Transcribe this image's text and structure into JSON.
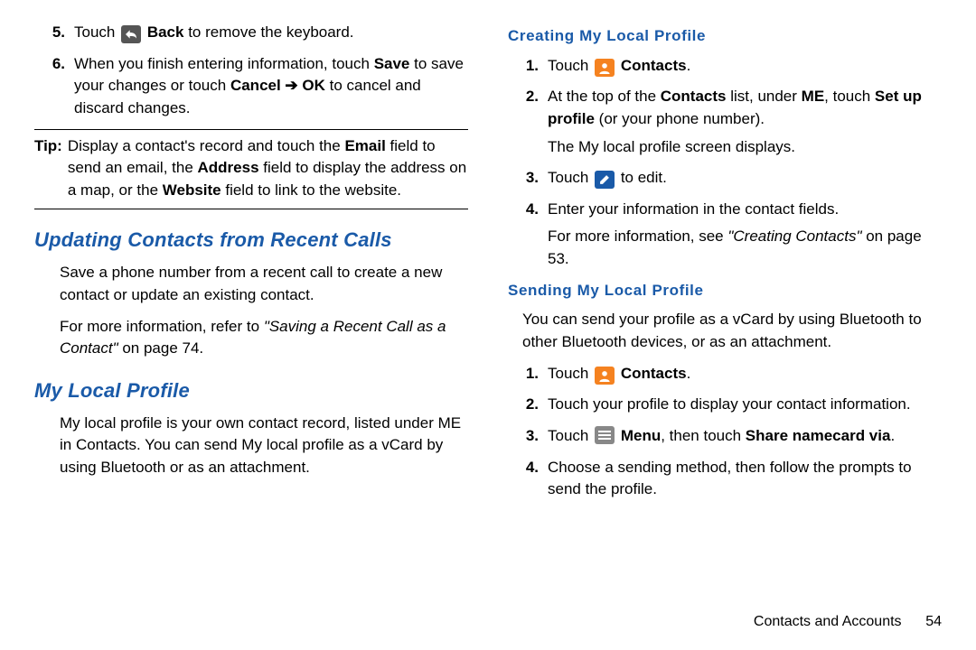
{
  "left": {
    "items56": {
      "5": {
        "num": "5.",
        "pre": "Touch ",
        "bold": "Back",
        "post": " to remove the keyboard."
      },
      "6": {
        "num": "6.",
        "t1": "When you finish entering information, touch ",
        "save": "Save",
        "t2": " to save your changes or touch ",
        "cancel": "Cancel",
        "arrow": " ➔ ",
        "ok": "OK",
        "t3": " to cancel and discard changes."
      }
    },
    "tip": {
      "label": "Tip:",
      "t1": "Display a contact's record and touch the ",
      "email": "Email",
      "t2": " field to send an email, the ",
      "address": "Address",
      "t3": " field to display the address on a map, or the ",
      "website": "Website",
      "t4": " field to link to the website."
    },
    "h_update": "Updating Contacts from Recent Calls",
    "update_p": "Save a phone number from a recent call to create a new contact or update an existing contact.",
    "update_ref_pre": "For more information, refer to ",
    "update_ref_italic": "\"Saving a Recent Call as a Contact\"",
    "update_ref_post": " on page 74.",
    "h_profile": "My Local Profile",
    "profile_p": "My local profile is your own contact record, listed under ME in Contacts. You can send My local profile as a vCard by using Bluetooth or as an attachment."
  },
  "right": {
    "h_create": "Creating My Local Profile",
    "create": {
      "1": {
        "num": "1.",
        "pre": "Touch ",
        "bold": "Contacts",
        "post": "."
      },
      "2": {
        "num": "2.",
        "t1": "At the top of the ",
        "contacts": "Contacts",
        "t2": " list, under ",
        "me": "ME",
        "t3": ", touch ",
        "setup": "Set up profile",
        "t4": " (or your phone number).",
        "sub": "The My local profile screen displays."
      },
      "3": {
        "num": "3.",
        "pre": "Touch ",
        "post": " to edit."
      },
      "4": {
        "num": "4.",
        "t1": "Enter your information in the contact fields.",
        "sub_pre": "For more information, see ",
        "sub_italic": "\"Creating Contacts\"",
        "sub_post": " on page 53."
      }
    },
    "h_send": "Sending My Local Profile",
    "send_p": "You can send your profile as a vCard by using Bluetooth to other Bluetooth devices, or as an attachment.",
    "send": {
      "1": {
        "num": "1.",
        "pre": "Touch ",
        "bold": "Contacts",
        "post": "."
      },
      "2": {
        "num": "2.",
        "text": "Touch your profile to display your contact information."
      },
      "3": {
        "num": "3.",
        "pre": "Touch ",
        "menu": "Menu",
        "mid": ", then touch ",
        "share": "Share namecard via",
        "post": "."
      },
      "4": {
        "num": "4.",
        "text": "Choose a sending method, then follow the prompts to send the profile."
      }
    },
    "footer_label": "Contacts and Accounts",
    "footer_page": "54"
  }
}
